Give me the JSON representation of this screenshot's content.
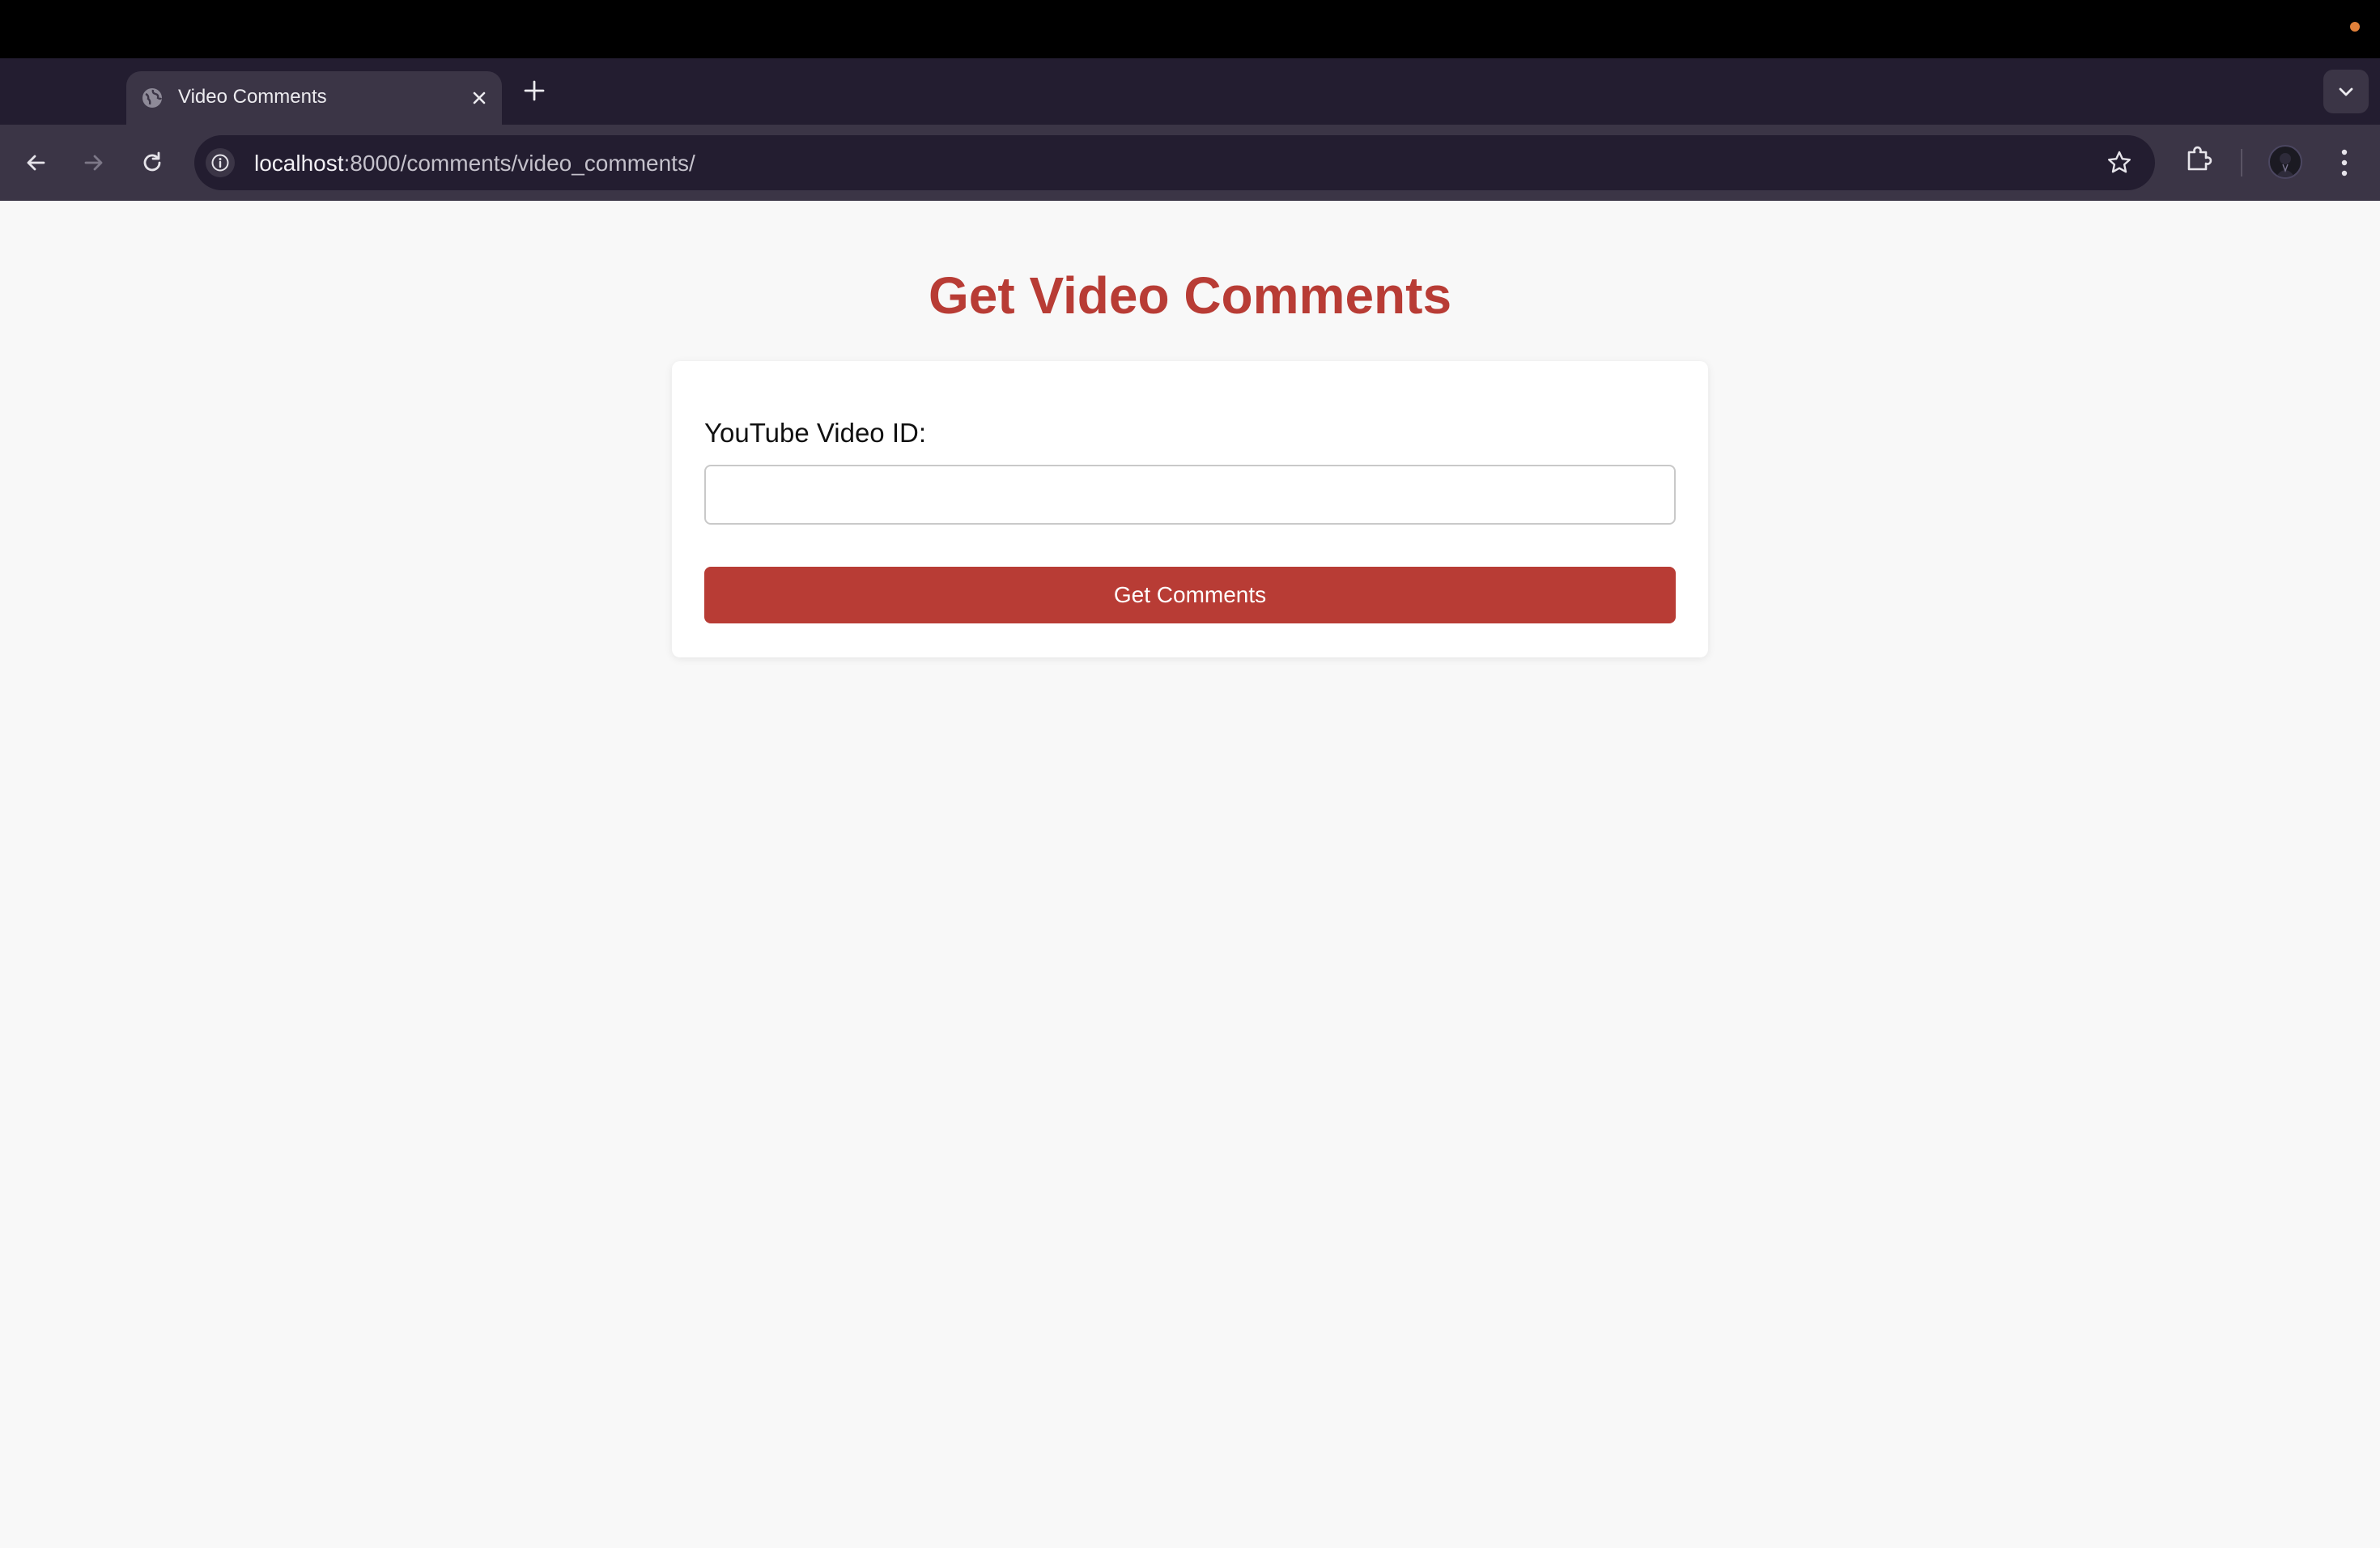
{
  "browser": {
    "tab": {
      "title": "Video Comments",
      "favicon": "globe-icon",
      "close_icon": "close-icon"
    },
    "new_tab_icon": "plus-icon",
    "tab_search_icon": "chevron-down-icon",
    "nav": {
      "back_icon": "arrow-left-icon",
      "forward_icon": "arrow-right-icon",
      "reload_icon": "reload-icon"
    },
    "omnibox": {
      "info_icon": "info-icon",
      "url_host": "localhost",
      "url_rest": ":8000/comments/video_comments/",
      "bookmark_icon": "star-icon"
    },
    "extensions_icon": "puzzle-icon",
    "profile_icon": "avatar",
    "menu_icon": "kebab-menu-icon"
  },
  "page": {
    "title": "Get Video Comments",
    "form": {
      "label": "YouTube Video ID:",
      "input_value": "",
      "input_placeholder": "",
      "submit_label": "Get Comments"
    }
  },
  "colors": {
    "accent": "#b83c35",
    "os_indicator": "#e0803a",
    "page_background": "#f8f8f8",
    "browser_frame": "#231d30",
    "browser_toolbar": "#3b3546"
  }
}
